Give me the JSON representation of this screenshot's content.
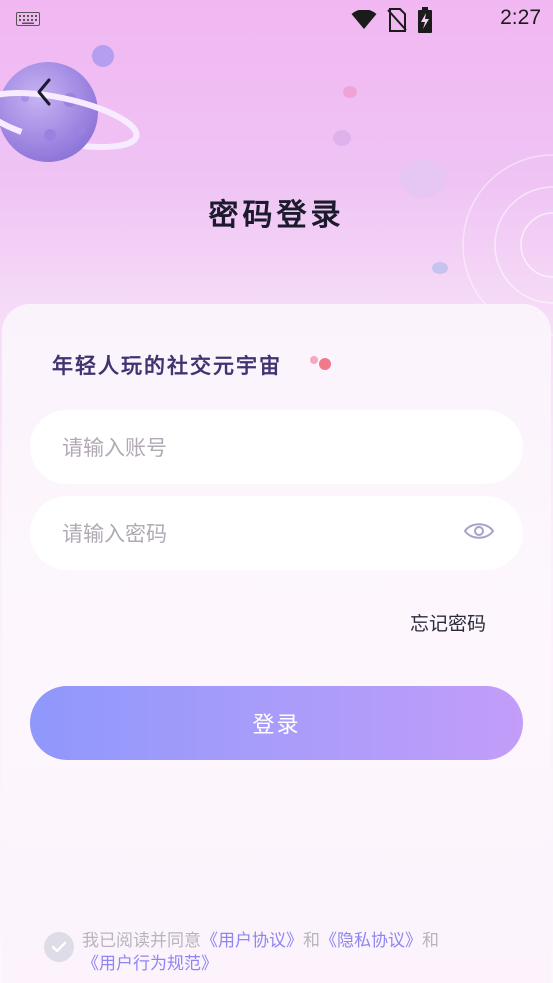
{
  "status_bar": {
    "time": "2:27",
    "icons": [
      "keyboard-icon",
      "wifi-icon",
      "no-sim-icon",
      "battery-charging-icon"
    ]
  },
  "header": {
    "title": "密码登录",
    "back_icon": "chevron-left-icon"
  },
  "card": {
    "slogan": "年轻人玩的社交元宇宙"
  },
  "form": {
    "account_placeholder": "请输入账号",
    "account_value": "",
    "password_placeholder": "请输入密码",
    "password_value": "",
    "password_toggle_icon": "eye-icon",
    "forgot_password": "忘记密码",
    "login_button": "登录"
  },
  "agreement": {
    "prefix": "我已阅读并同意",
    "user_agreement": "《用户协议》",
    "and1": "和",
    "privacy_agreement": "《隐私协议》",
    "and2": "和",
    "behavior_rules": "《用户行为规范》",
    "checked": false
  },
  "colors": {
    "accent": "#8e86f0",
    "button_start": "#8f98fb",
    "button_end": "#c29df9",
    "title": "#1c1b2e",
    "slogan": "#3f3470"
  }
}
